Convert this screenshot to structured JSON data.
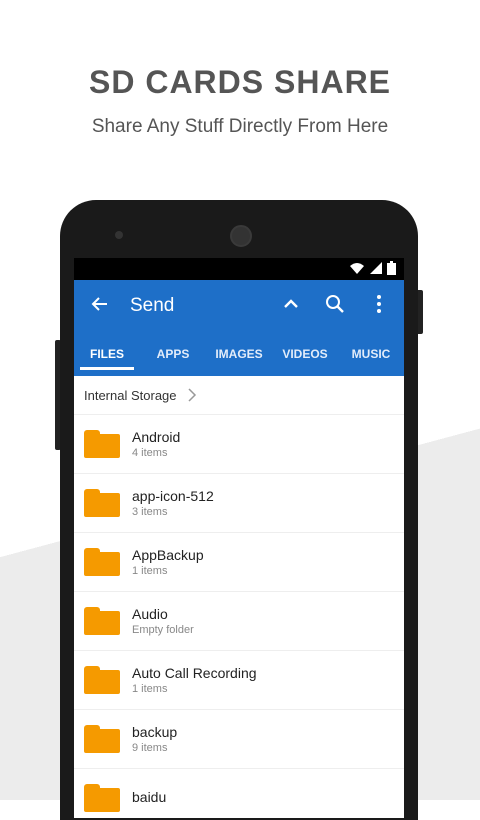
{
  "promo": {
    "title": "SD CARDS SHARE",
    "subtitle": "Share Any Stuff Directly From Here"
  },
  "appbar": {
    "title": "Send"
  },
  "tabs": [
    {
      "label": "FILES",
      "active": true
    },
    {
      "label": "APPS",
      "active": false
    },
    {
      "label": "IMAGES",
      "active": false
    },
    {
      "label": "VIDEOS",
      "active": false
    },
    {
      "label": "MUSIC",
      "active": false
    }
  ],
  "breadcrumb": {
    "label": "Internal Storage"
  },
  "files": [
    {
      "name": "Android",
      "meta": "4 items"
    },
    {
      "name": "app-icon-512",
      "meta": "3 items"
    },
    {
      "name": "AppBackup",
      "meta": "1 items"
    },
    {
      "name": "Audio",
      "meta": "Empty folder"
    },
    {
      "name": "Auto Call Recording",
      "meta": "1 items"
    },
    {
      "name": "backup",
      "meta": "9 items"
    },
    {
      "name": "baidu",
      "meta": ""
    }
  ],
  "colors": {
    "primary": "#1e6fc8",
    "folder": "#f59a00"
  },
  "icons": {
    "back": "arrow-left-icon",
    "collapse": "chevron-up-icon",
    "search": "search-icon",
    "more": "more-vert-icon",
    "wifi": "wifi-icon",
    "signal": "signal-icon",
    "battery": "battery-icon",
    "folder": "folder-icon",
    "breadcrumb_chevron": "chevron-right-icon"
  }
}
